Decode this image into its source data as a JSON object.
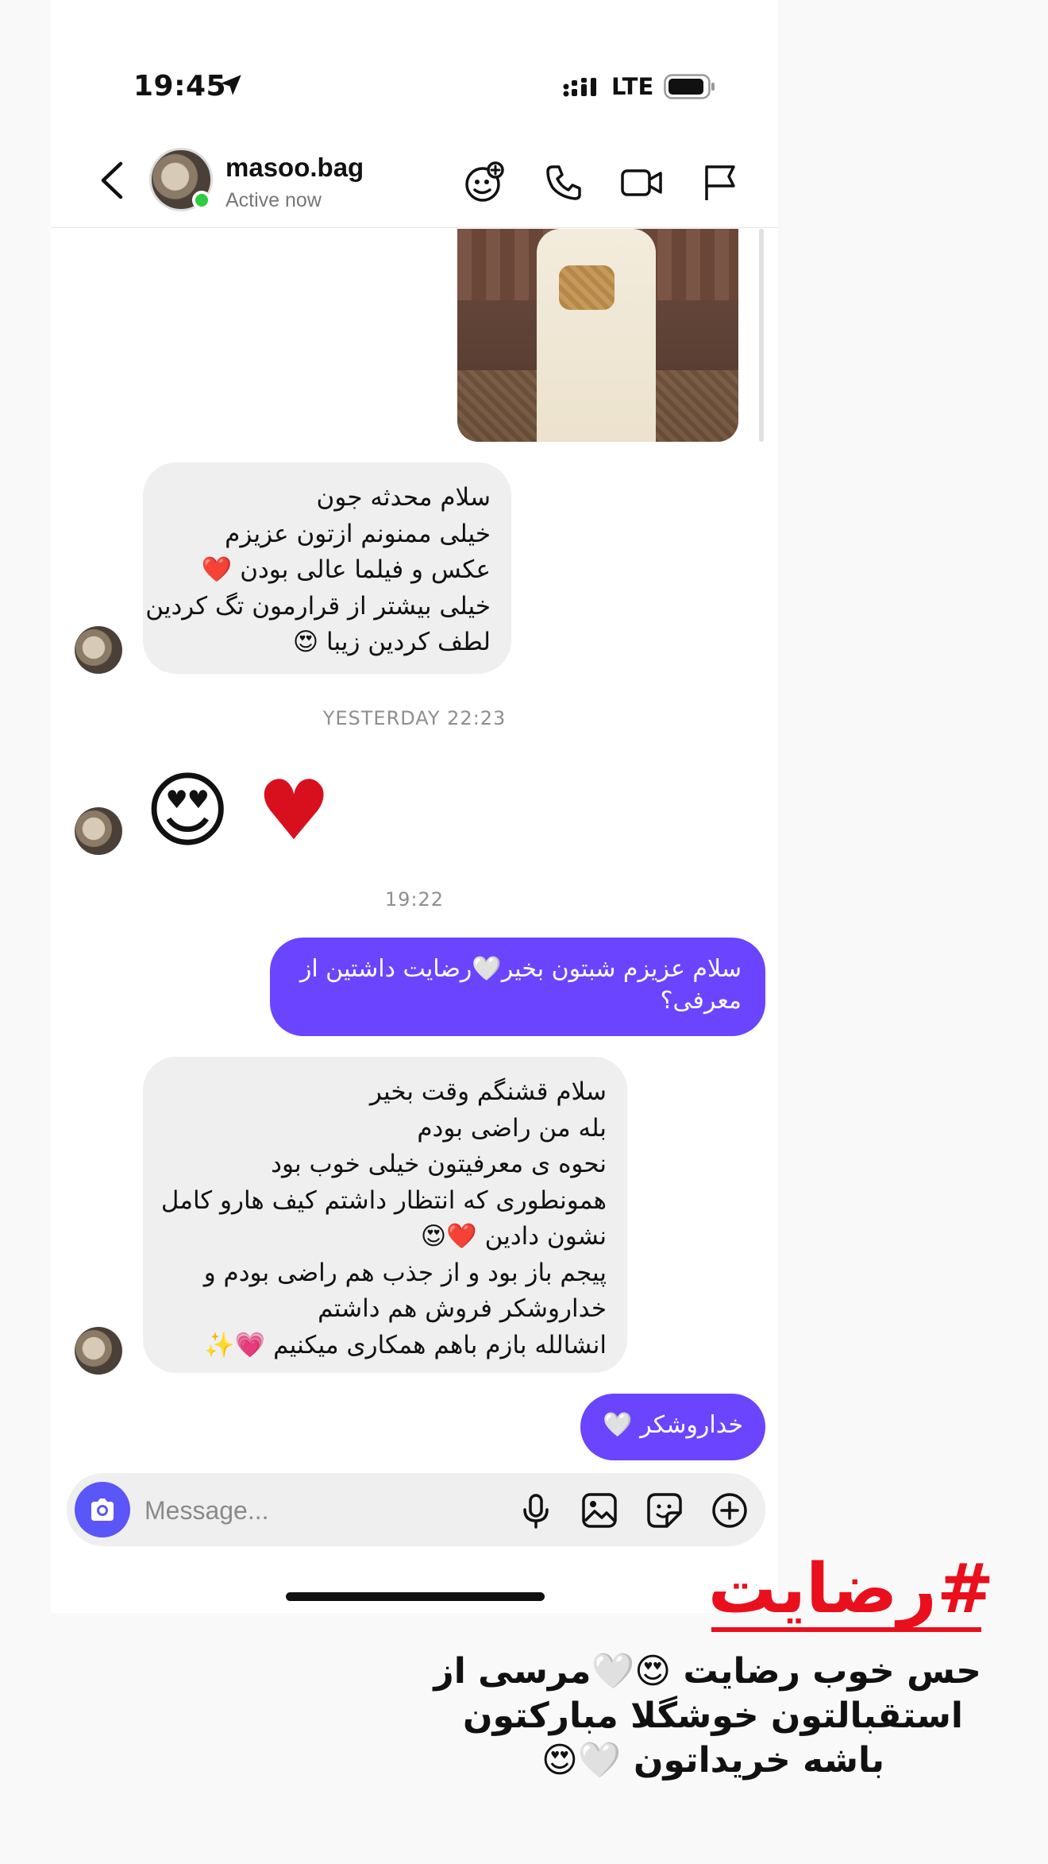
{
  "status_bar": {
    "time": "19:45",
    "network": "LTE"
  },
  "header": {
    "username": "masoo.bag",
    "status": "Active now"
  },
  "messages": {
    "msg1": {
      "lines": [
        "سلام محدثه جون",
        "خیلی ممنونم ازتون عزیزم",
        "عکس و فیلما عالی بودن ❤️",
        "خیلی بیشتر از قرارمون تگ کردین",
        "لطف کردین زیبا 😍"
      ]
    },
    "time1": "YESTERDAY 22:23",
    "msg2": {
      "emoji_face": "😍",
      "emoji_heart": "♥"
    },
    "time2": "19:22",
    "msg3": {
      "text": "سلام عزیزم شبتون بخیر🤍رضایت داشتین از معرفی؟"
    },
    "msg4": {
      "lines": [
        "سلام قشنگم وقت بخیر",
        "بله من راضی بودم",
        "نحوه ی معرفیتون خیلی خوب بود",
        "همونطوری که انتظار داشتم کیف هارو کامل",
        "نشون دادین ❤️😍",
        "پیجم باز بود و از جذب هم راضی بودم و",
        "خداروشکر فروش هم داشتم",
        "انشالله بازم باهم همکاری میکنیم 💗✨"
      ]
    },
    "msg5": {
      "text": "خداروشکر 🤍"
    }
  },
  "composer": {
    "placeholder": "Message..."
  },
  "overlay": {
    "hashtag": "#رضایت",
    "caption_lines": [
      "حس خوب رضایت 😍🤍مرسی از",
      "استقبالتون خوشگلا مبارکتون",
      "باشه خریداتون 🤍😍"
    ],
    "hashtag_color": "#ea0f1c"
  },
  "colors": {
    "outgoing_bubble": "#6a44ff",
    "incoming_bubble": "#efefef",
    "camera_button": "#5b56f7",
    "online_dot": "#2ecc40"
  },
  "icons": [
    "location-arrow-icon",
    "signal-icon",
    "battery-icon",
    "back-icon",
    "add-effect-icon",
    "phone-icon",
    "video-icon",
    "flag-icon",
    "camera-icon",
    "microphone-icon",
    "gallery-icon",
    "sticker-icon",
    "plus-icon"
  ]
}
